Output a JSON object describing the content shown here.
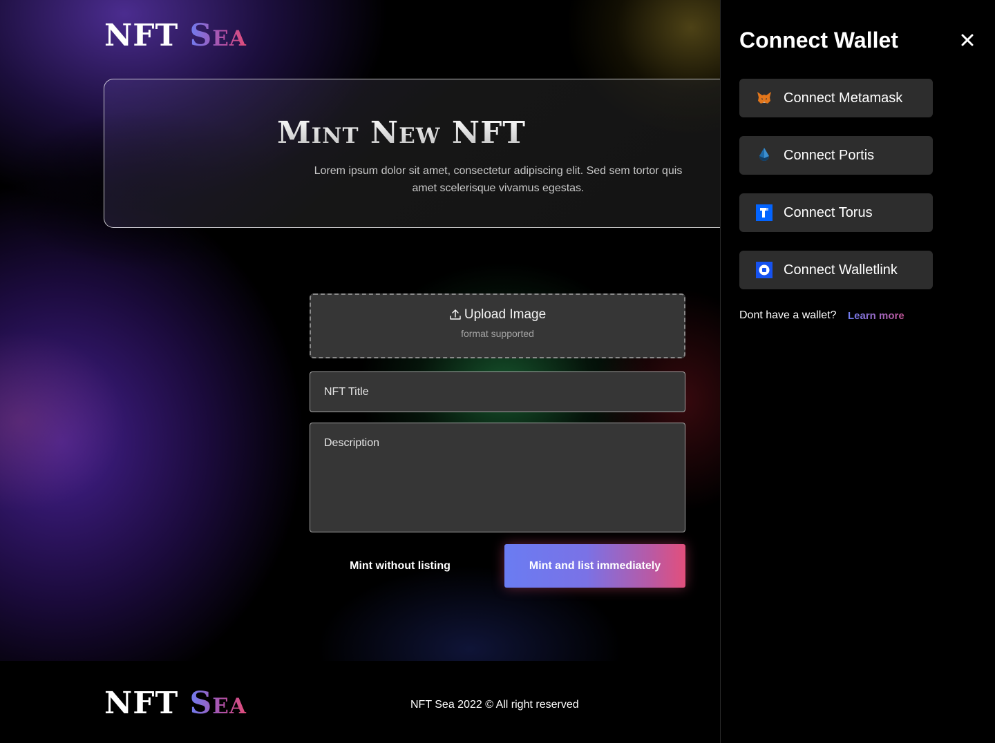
{
  "brand": {
    "name_part1": "NFT",
    "name_part2": "Sea"
  },
  "hero": {
    "title": "Mint New NFT",
    "subtitle": "Lorem ipsum dolor sit amet, consectetur adipiscing elit. Sed sem tortor quis amet scelerisque vivamus egestas."
  },
  "form": {
    "upload_label": "Upload Image",
    "upload_hint": "format supported",
    "title_placeholder": "NFT Title",
    "description_placeholder": "Description",
    "mint_secondary_label": "Mint without listing",
    "mint_primary_label": "Mint and list immediately"
  },
  "footer": {
    "copyright": "NFT Sea 2022 © All right reserved"
  },
  "wallet_panel": {
    "title": "Connect Wallet",
    "options": [
      {
        "label": "Connect Metamask",
        "icon": "metamask-icon"
      },
      {
        "label": "Connect Portis",
        "icon": "portis-icon"
      },
      {
        "label": "Connect Torus",
        "icon": "torus-icon"
      },
      {
        "label": "Connect Walletlink",
        "icon": "walletlink-icon"
      }
    ],
    "no_wallet_text": "Dont have a wallet?",
    "learn_more_label": "Learn more"
  },
  "colors": {
    "accent_blue": "#6a7cf2",
    "accent_pink": "#e24f7c",
    "panel_button_bg": "#2d2d2d",
    "input_bg": "#363636"
  }
}
